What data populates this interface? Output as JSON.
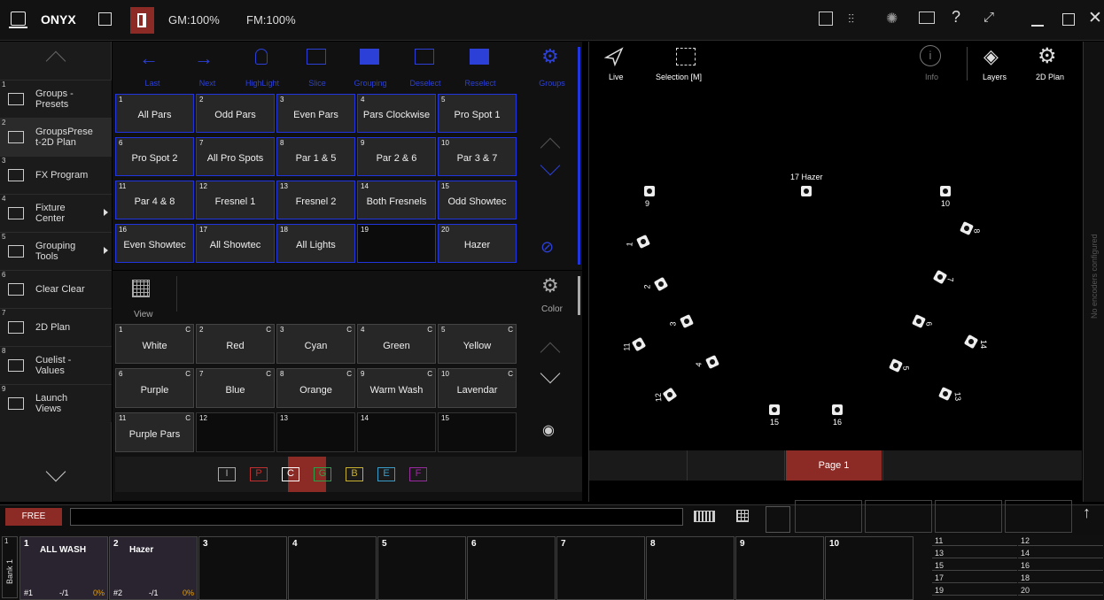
{
  "topbar": {
    "app_name": "ONYX",
    "gm": "GM:",
    "gm_value": "100%",
    "fm": "FM:",
    "fm_value": "100%"
  },
  "leftnav": [
    {
      "num": "1",
      "label": "Groups -\nPresets"
    },
    {
      "num": "2",
      "label": "GroupsPrese\nt-2D Plan"
    },
    {
      "num": "3",
      "label": "FX Program"
    },
    {
      "num": "4",
      "label": "Fixture\nCenter"
    },
    {
      "num": "5",
      "label": "Grouping\nTools"
    },
    {
      "num": "6",
      "label": "Clear Clear"
    },
    {
      "num": "7",
      "label": "2D Plan"
    },
    {
      "num": "8",
      "label": "Cuelist -\nValues"
    },
    {
      "num": "9",
      "label": "Launch\nViews"
    }
  ],
  "groups": {
    "toolbar": [
      "Last",
      "Next",
      "HighLight",
      "Slice",
      "Grouping",
      "Deselect",
      "Reselect"
    ],
    "title": "Groups",
    "items": [
      {
        "n": "1",
        "label": "All Pars"
      },
      {
        "n": "2",
        "label": "Odd Pars"
      },
      {
        "n": "3",
        "label": "Even Pars"
      },
      {
        "n": "4",
        "label": "Pars Clockwise"
      },
      {
        "n": "5",
        "label": "Pro Spot 1"
      },
      {
        "n": "6",
        "label": "Pro Spot 2"
      },
      {
        "n": "7",
        "label": "All Pro Spots"
      },
      {
        "n": "8",
        "label": "Par 1 & 5"
      },
      {
        "n": "9",
        "label": "Par 2 & 6"
      },
      {
        "n": "10",
        "label": "Par 3 & 7"
      },
      {
        "n": "11",
        "label": "Par 4 & 8"
      },
      {
        "n": "12",
        "label": "Fresnel 1"
      },
      {
        "n": "13",
        "label": "Fresnel 2"
      },
      {
        "n": "14",
        "label": "Both Fresnels"
      },
      {
        "n": "15",
        "label": "Odd Showtec"
      },
      {
        "n": "16",
        "label": "Even Showtec"
      },
      {
        "n": "17",
        "label": "All Showtec"
      },
      {
        "n": "18",
        "label": "All Lights"
      },
      {
        "n": "19",
        "label": ""
      },
      {
        "n": "20",
        "label": "Hazer"
      }
    ]
  },
  "colors": {
    "view_label": "View",
    "title": "Color",
    "items": [
      {
        "n": "1",
        "label": "White",
        "c": "C"
      },
      {
        "n": "2",
        "label": "Red",
        "c": "C"
      },
      {
        "n": "3",
        "label": "Cyan",
        "c": "C"
      },
      {
        "n": "4",
        "label": "Green",
        "c": "C"
      },
      {
        "n": "5",
        "label": "Yellow",
        "c": "C"
      },
      {
        "n": "6",
        "label": "Purple",
        "c": "C"
      },
      {
        "n": "7",
        "label": "Blue",
        "c": "C"
      },
      {
        "n": "8",
        "label": "Orange",
        "c": "C"
      },
      {
        "n": "9",
        "label": "Warm Wash",
        "c": "C"
      },
      {
        "n": "10",
        "label": "Lavendar",
        "c": "C"
      },
      {
        "n": "11",
        "label": "Purple Pars",
        "c": "C"
      },
      {
        "n": "12",
        "label": "",
        "c": ""
      },
      {
        "n": "13",
        "label": "",
        "c": ""
      },
      {
        "n": "14",
        "label": "",
        "c": ""
      },
      {
        "n": "15",
        "label": "",
        "c": ""
      }
    ],
    "filters": [
      {
        "letter": "I",
        "color": "#aaaaaa"
      },
      {
        "letter": "P",
        "color": "#c03030"
      },
      {
        "letter": "C",
        "color": "#ffffff"
      },
      {
        "letter": "G",
        "color": "#2fa04a"
      },
      {
        "letter": "B",
        "color": "#c8b030"
      },
      {
        "letter": "E",
        "color": "#3a9cc8"
      },
      {
        "letter": "F",
        "color": "#9a2aa0"
      }
    ]
  },
  "plan": {
    "live": "Live",
    "selection": "Selection [M]",
    "info": "Info",
    "layers": "Layers",
    "plan2d": "2D Plan",
    "page": "Page 1",
    "encoders": "No encoders configured",
    "fixtures": [
      "9",
      "10",
      "17 Hazer",
      "8",
      "1",
      "7",
      "2",
      "6",
      "3",
      "14",
      "11",
      "4",
      "5",
      "13",
      "12",
      "15",
      "16"
    ]
  },
  "cmd": {
    "free": "FREE"
  },
  "playbacks": {
    "bank": "Bank 1",
    "bank_num": "1",
    "items": [
      {
        "n": "1",
        "label": "ALL WASH",
        "cue": "#1",
        "info": "-/1",
        "pct": "0%"
      },
      {
        "n": "2",
        "label": "Hazer",
        "cue": "#2",
        "info": "-/1",
        "pct": "0%"
      },
      {
        "n": "3",
        "label": ""
      },
      {
        "n": "4",
        "label": ""
      },
      {
        "n": "5",
        "label": ""
      },
      {
        "n": "6",
        "label": ""
      },
      {
        "n": "7",
        "label": ""
      },
      {
        "n": "8",
        "label": ""
      },
      {
        "n": "9",
        "label": ""
      },
      {
        "n": "10",
        "label": ""
      }
    ],
    "small": [
      "11",
      "12",
      "13",
      "14",
      "15",
      "16",
      "17",
      "18",
      "19",
      "20"
    ]
  }
}
